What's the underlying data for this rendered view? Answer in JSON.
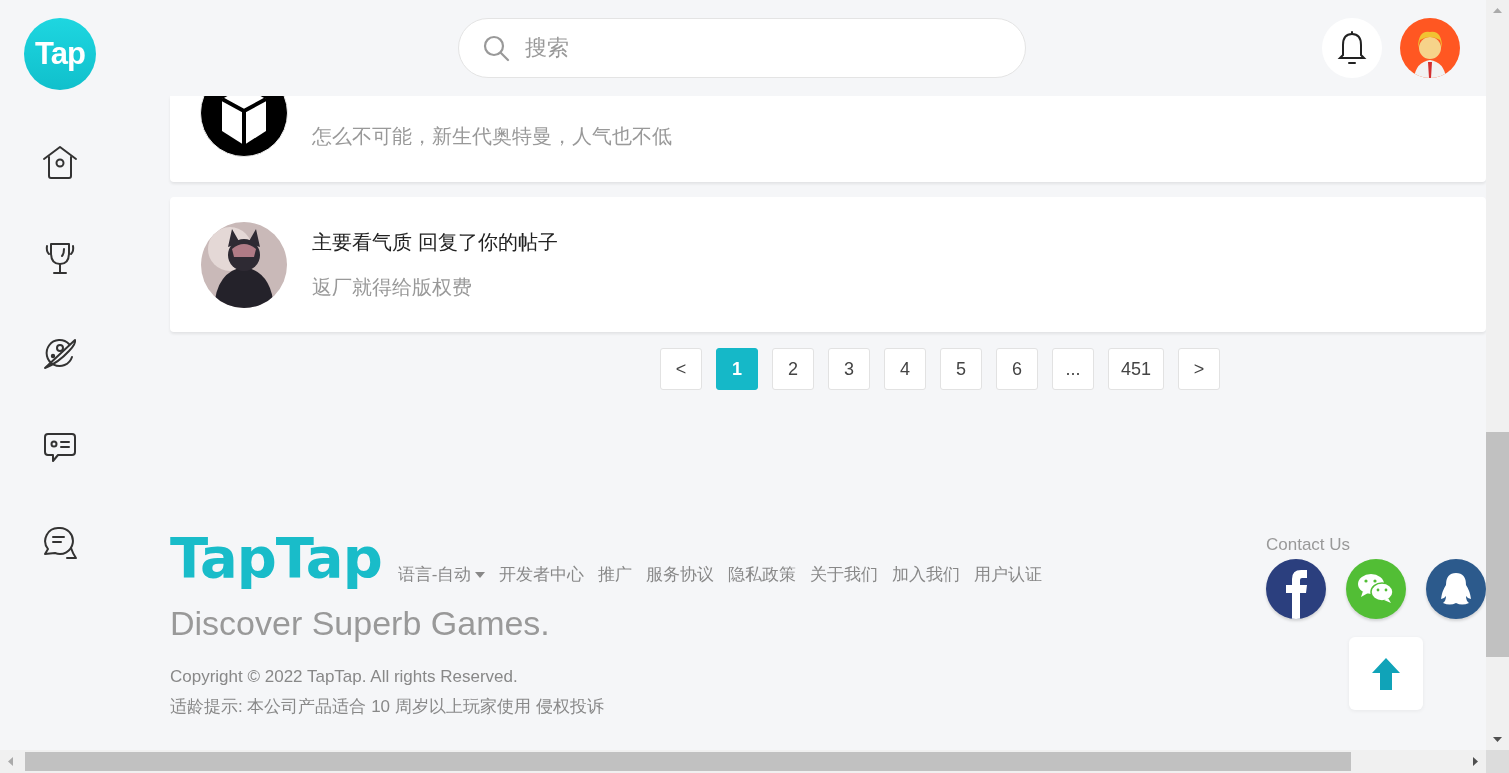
{
  "sidebar": {
    "logo": "Tap",
    "items": [
      {
        "kind": "home"
      },
      {
        "kind": "trophy"
      },
      {
        "kind": "planet"
      },
      {
        "kind": "card"
      },
      {
        "kind": "chat"
      }
    ]
  },
  "header": {
    "search": {
      "placeholder": "搜索"
    }
  },
  "notifications": [
    {
      "kind": "book",
      "body": "怎么不可能，新生代奥特曼，人气也不低"
    },
    {
      "kind": "picture",
      "title": "主要看气质 回复了你的帖子",
      "body": "返厂就得给版权费"
    }
  ],
  "pagination": {
    "prev": "<",
    "next": ">",
    "pages": [
      {
        "label": "1",
        "selected": true
      },
      {
        "label": "2",
        "selected": false
      },
      {
        "label": "3",
        "selected": false
      },
      {
        "label": "4",
        "selected": false
      },
      {
        "label": "5",
        "selected": false
      },
      {
        "label": "6",
        "selected": false
      },
      {
        "label": "...",
        "selected": false
      },
      {
        "label": "451",
        "selected": false
      }
    ]
  },
  "footer": {
    "logo": "TapTap",
    "language": "语言-自动",
    "links": [
      "开发者中心",
      "推广",
      "服务协议",
      "隐私政策",
      "关于我们",
      "加入我们",
      "用户认证"
    ],
    "slogan": "Discover Superb Games.",
    "copyright": "Copyright © 2022 TapTap. All rights Reserved.",
    "notice": "适龄提示: 本公司产品适合 10 周岁以上玩家使用",
    "complaint": "侵权投诉",
    "contact_title": "Contact Us",
    "social": [
      {
        "kind": "facebook"
      },
      {
        "kind": "wechat"
      },
      {
        "kind": "qq"
      }
    ]
  }
}
